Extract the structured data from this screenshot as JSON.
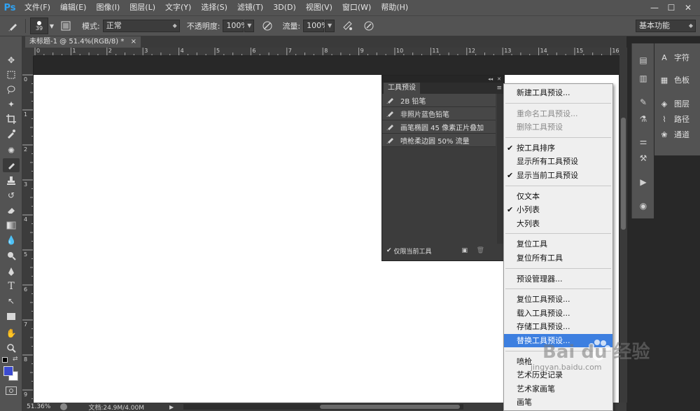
{
  "app": {
    "logo": "Ps"
  },
  "menubar": {
    "items": [
      "文件(F)",
      "编辑(E)",
      "图像(I)",
      "图层(L)",
      "文字(Y)",
      "选择(S)",
      "滤镜(T)",
      "3D(D)",
      "视图(V)",
      "窗口(W)",
      "帮助(H)"
    ]
  },
  "window_controls": {
    "minimize": "—",
    "restore": "☐",
    "close": "✕"
  },
  "options": {
    "brush_size": "39",
    "mode_label": "模式:",
    "mode_value": "正常",
    "opacity_label": "不透明度:",
    "opacity_value": "100%",
    "flow_label": "流量:",
    "flow_value": "100%",
    "workspace_value": "基本功能"
  },
  "document": {
    "tab_title": "未标题-1 @ 51.4%(RGB/8) *",
    "tab_close": "×"
  },
  "rulers": {
    "top": [
      "0",
      "1",
      "2",
      "3",
      "4",
      "5",
      "6",
      "7",
      "8",
      "9",
      "10",
      "11",
      "12",
      "13",
      "14",
      "15",
      "16"
    ],
    "left": [
      "0",
      "1",
      "2",
      "3",
      "4",
      "5",
      "6",
      "7",
      "8",
      "9"
    ]
  },
  "status": {
    "zoom": "51.36%",
    "doc_info": "文档:24.9M/4.00M"
  },
  "right_panel": {
    "items": [
      {
        "label": "字符",
        "icon": "character-icon"
      },
      {
        "label": "色板",
        "icon": "swatches-icon"
      },
      {
        "label": "图层",
        "icon": "layers-icon"
      },
      {
        "label": "路径",
        "icon": "paths-icon"
      },
      {
        "label": "通道",
        "icon": "channels-icon"
      }
    ]
  },
  "presets_panel": {
    "tab_label": "工具预设",
    "items": [
      "2B 铅笔",
      "非照片蓝色铅笔",
      "画笔椭圆 45 像素正片叠加",
      "喷枪柔边圆 50% 流量"
    ],
    "footer_label": "仅限当前工具"
  },
  "context_menu": {
    "groups": [
      [
        {
          "label": "新建工具预设...",
          "checked": false,
          "disabled": false
        }
      ],
      [
        {
          "label": "重命名工具预设...",
          "checked": false,
          "disabled": true
        },
        {
          "label": "删除工具预设",
          "checked": false,
          "disabled": true
        }
      ],
      [
        {
          "label": "按工具排序",
          "checked": true,
          "disabled": false
        },
        {
          "label": "显示所有工具预设",
          "checked": false,
          "disabled": false
        },
        {
          "label": "显示当前工具预设",
          "checked": true,
          "disabled": false
        }
      ],
      [
        {
          "label": "仅文本",
          "checked": false,
          "disabled": false
        },
        {
          "label": "小列表",
          "checked": true,
          "disabled": false
        },
        {
          "label": "大列表",
          "checked": false,
          "disabled": false
        }
      ],
      [
        {
          "label": "复位工具",
          "checked": false,
          "disabled": false
        },
        {
          "label": "复位所有工具",
          "checked": false,
          "disabled": false
        }
      ],
      [
        {
          "label": "预设管理器...",
          "checked": false,
          "disabled": false
        }
      ],
      [
        {
          "label": "复位工具预设...",
          "checked": false,
          "disabled": false
        },
        {
          "label": "载入工具预设...",
          "checked": false,
          "disabled": false
        },
        {
          "label": "存储工具预设...",
          "checked": false,
          "disabled": false
        },
        {
          "label": "替换工具预设...",
          "checked": false,
          "disabled": false,
          "highlighted": true
        }
      ],
      [
        {
          "label": "喷枪",
          "checked": false,
          "disabled": false
        },
        {
          "label": "艺术历史记录",
          "checked": false,
          "disabled": false
        },
        {
          "label": "艺术家画笔",
          "checked": false,
          "disabled": false
        },
        {
          "label": "画笔",
          "checked": false,
          "disabled": false
        }
      ]
    ]
  },
  "colors": {
    "highlight": "#3d7fe0",
    "foreground_swatch": "#3b4bd0",
    "background_swatch": "#ffffff",
    "ps_logo": "#2fa3f4"
  },
  "watermark": {
    "brand": "Bai du 经验",
    "url": "jingyan.baidu.com"
  }
}
